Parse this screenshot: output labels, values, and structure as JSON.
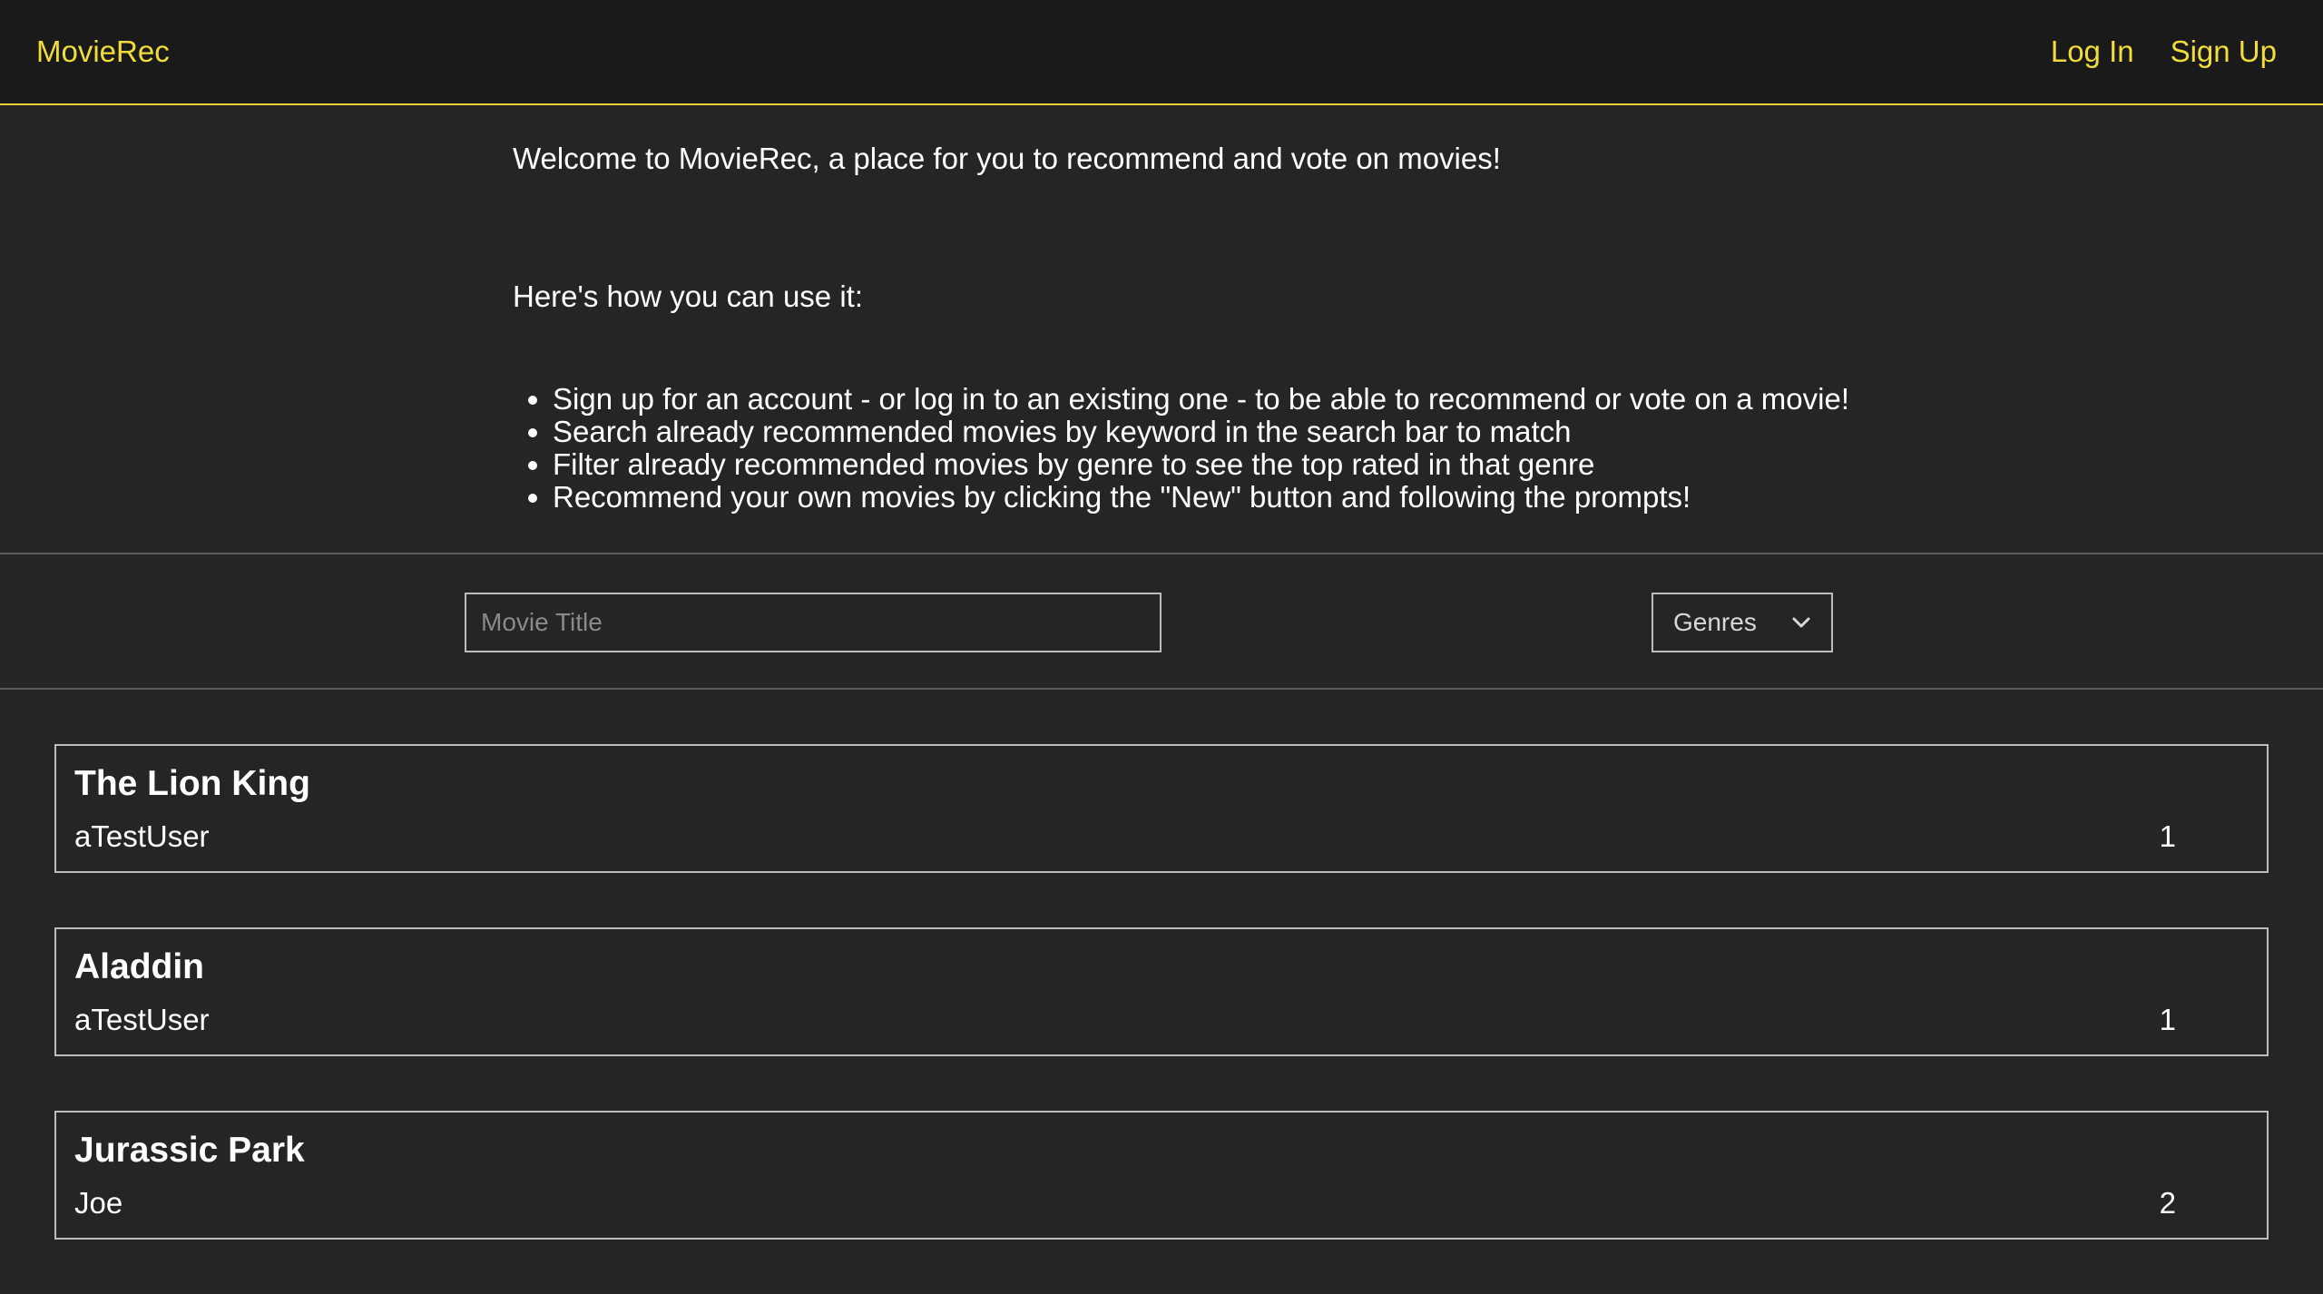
{
  "navbar": {
    "brand": "MovieRec",
    "login_label": "Log In",
    "signup_label": "Sign Up",
    "accent_color": "#f0dc3c"
  },
  "intro": {
    "welcome": "Welcome to MovieRec, a place for you to recommend and vote on movies!",
    "how_to": "Here's how you can use it:",
    "steps": [
      "Sign up for an account - or log in to an existing one - to be able to recommend or vote on a movie!",
      "Search already recommended movies by keyword in the search bar to match",
      "Filter already recommended movies by genre to see the top rated in that genre",
      "Recommend your own movies by clicking the \"New\" button and following the prompts!"
    ]
  },
  "filters": {
    "search_placeholder": "Movie Title",
    "search_value": "",
    "genre_selected": "Genres",
    "genre_icon": "chevron-down-icon"
  },
  "movies": [
    {
      "title": "The Lion King",
      "user": "aTestUser",
      "votes": "1"
    },
    {
      "title": "Aladdin",
      "user": "aTestUser",
      "votes": "1"
    },
    {
      "title": "Jurassic Park",
      "user": "Joe",
      "votes": "2"
    }
  ]
}
